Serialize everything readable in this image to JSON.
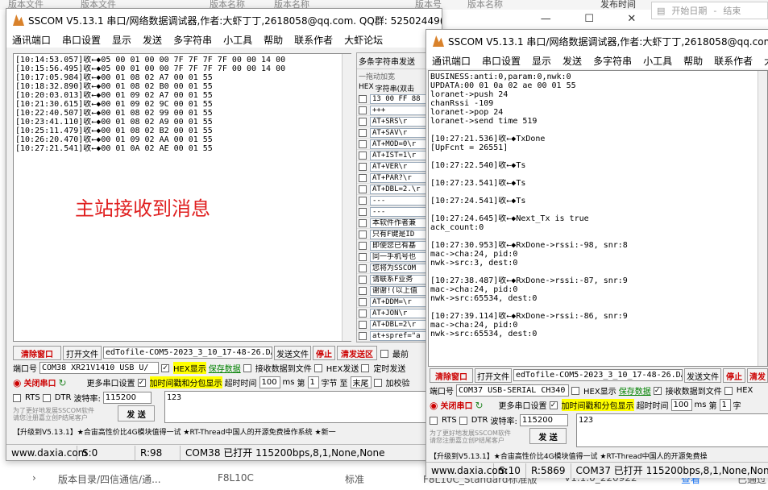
{
  "bg": {
    "top_tabs": [
      "版本文件",
      "版本文件",
      "版本名称",
      "版本名称",
      "版本号",
      "版本名称",
      "发布时间"
    ],
    "start_date": "开始日期",
    "sep": "-",
    "end_date": "结束",
    "bottom_row": [
      "版本目录/四信通信/通...",
      "F8L10C",
      "标准",
      "F8L10C_Standard标准版",
      "V1.1.0_220922",
      "查看",
      "已通过"
    ]
  },
  "win1": {
    "title": "SSCOM V5.13.1 串口/网络数据调试器,作者:大虾丁丁,2618058@qq.com. QQ群: 52502449(最新版本)",
    "menu": [
      "通讯端口",
      "串口设置",
      "显示",
      "发送",
      "多字符串",
      "小工具",
      "帮助",
      "联系作者",
      "大虾论坛"
    ],
    "log": [
      "[10:14:53.057]收←◆05 00 01 00 00 7F 7F 7F 7F 00 00 14 00",
      "[10:15:56.495]收←◆05 00 01 00 00 7F 7F 7F 7F 00 00 14 00",
      "[10:17:05.984]收←◆00 01 08 02 A7 00 01 55",
      "[10:18:32.890]收←◆00 01 08 02 B0 00 01 55",
      "[10:20:03.013]收←◆00 01 09 02 A7 00 01 55",
      "[10:21:30.615]收←◆00 01 09 02 9C 00 01 55",
      "[10:22:40.507]收←◆00 01 08 02 99 00 01 55",
      "[10:23:41.110]收←◆00 01 08 02 A9 00 01 55",
      "[10:25:11.479]收←◆00 01 08 02 B2 00 01 55",
      "[10:26:20.470]收←◆00 01 09 02 AA 00 01 55",
      "[10:27:21.541]收←◆00 01 0A 02 AE 00 01 55"
    ],
    "annotation": "主站接收到消息",
    "multi_title": "多条字符串发送",
    "multi_hint": "一拖动加宽",
    "multi_hex": "HEX",
    "multi_header": "字符串(双击",
    "multi_items": [
      "13 00 FF 88",
      "+++",
      "AT+SRS\\r",
      "AT+SAV\\r",
      "AT+MOD=0\\r",
      "AT+IST=1\\r",
      "AT+VER\\r",
      "AT+PAR?\\r",
      "AT+DBL=2.\\r",
      "---",
      "---",
      "本软件作者兼",
      "只有F键是ID",
      "即使您已有基",
      "同一手机号也",
      "您将为SSCOM",
      "请联系F业务",
      "谢谢!(以上值",
      "AT+DDM=\\r",
      "AT+JON\\r",
      "AT+DBL=2\\r",
      "at+spref=\"a"
    ],
    "btn_clear": "清除窗口",
    "btn_open": "打开文件",
    "file_path": "edTofile-COM5-2023_3_10_17-48-26.DAT",
    "btn_send_file": "发送文件",
    "btn_stop": "停止",
    "btn_clear_send": "清发送区",
    "chk_top": "最前",
    "port_label": "端口号",
    "port_value": "COM38 XR21V1410 USB U/",
    "hex_display": "HEX显示",
    "save_data": "保存数据",
    "recv_to_file": "接收数据到文件",
    "hex_send": "HEX发送",
    "timed_send": "定时发送",
    "btn_close_port": "关闭串口",
    "more_settings": "更多串口设置",
    "add_timestamp": "加时间戳和分包显示",
    "timeout_label": "超时时间",
    "timeout_value": "100",
    "ms": "ms",
    "nth": "第",
    "nth_value": "1",
    "bytes": "字节",
    "to": "至",
    "to_value": "末尾",
    "add_check": "加校验",
    "rts": "RTS",
    "dtr": "DTR",
    "baud_label": "波特率:",
    "baud_value": "115200",
    "send_text": "123",
    "promo": "为了更好地发展SSCOM软件\n请您注册嘉立创P结尾客户",
    "btn_send": "发 送",
    "ticker": "【升级到V5.13.1】★合宙高性价比4G模块值得一试  ★RT-Thread中国人的开源免费操作系统  ★新一",
    "status": [
      "www.daxia.com",
      "S:0",
      "R:98",
      "COM38 已打开  115200bps,8,1,None,None"
    ]
  },
  "win2": {
    "title": "SSCOM V5.13.1 串口/网络数据调试器,作者:大虾丁丁,2618058@qq.com. QQ群: 52502449(最新版本)",
    "menu": [
      "通讯端口",
      "串口设置",
      "显示",
      "发送",
      "多字符串",
      "小工具",
      "帮助",
      "联系作者",
      "大虾论坛"
    ],
    "log": [
      "BUSINESS:anti:0,param:0,nwk:0",
      "UPDATA:00 01 0a 02 ae 00 01 55",
      "loranet->push 24",
      "chanRssi -109",
      "loranet->pop 24",
      "loranet->send time 519",
      "",
      "[10:27:21.536]收←◆TxDone",
      "[UpFcnt = 26551]",
      "",
      "[10:27:22.540]收←◆Ts",
      "",
      "[10:27:23.541]收←◆Ts",
      "",
      "[10:27:24.541]收←◆Ts",
      "",
      "[10:27:24.645]收←◆Next_Tx is true",
      "ack_count:0",
      "",
      "[10:27:30.953]收←◆RxDone->rssi:-98, snr:8",
      "mac->cha:24, pid:0",
      "nwk->src:3, dest:0",
      "",
      "[10:27:38.487]收←◆RxDone->rssi:-87, snr:9",
      "mac->cha:24, pid:0",
      "nwk->src:65534, dest:0",
      "",
      "[10:27:39.114]收←◆RxDone->rssi:-86, snr:9",
      "mac->cha:24, pid:0",
      "nwk->src:65534, dest:0"
    ],
    "btn_clear": "清除窗口",
    "btn_open": "打开文件",
    "file_path": "edTofile-COM5-2023_3_10_17-48-26.DAT",
    "btn_send_file": "发送文件",
    "btn_stop": "停止",
    "btn_clear_send": "清发",
    "port_label": "端口号",
    "port_value": "COM37 USB-SERIAL CH340",
    "hex_display": "HEX显示",
    "save_data": "保存数据",
    "recv_to_file": "接收数据到文件",
    "hex_send": "HEX",
    "btn_close_port": "关闭串口",
    "more_settings": "更多串口设置",
    "add_timestamp": "加时间戳和分包显示",
    "timeout_label": "超时时间",
    "timeout_value": "100",
    "ms": "ms",
    "nth": "第",
    "nth_value": "1",
    "bytes": "字",
    "rts": "RTS",
    "dtr": "DTR",
    "baud_label": "波特率:",
    "baud_value": "115200",
    "send_text": "123",
    "promo": "为了更好地发展SSCOM软件\n请您注册嘉立创P结尾客户",
    "btn_send": "发 送",
    "ticker": "【升级到V5.13.1】★合宙高性价比4G模块值得一试  ★RT-Thread中国人的开源免费操",
    "status": [
      "www.daxia.com",
      "S:10",
      "R:5869",
      "COM37 已打开  115200bps,8,1,None,None"
    ]
  },
  "colors": {
    "annotation": "#e02020",
    "hex_highlight": "#ffff00",
    "green_link": "#008000",
    "red_label": "#cc0000"
  }
}
